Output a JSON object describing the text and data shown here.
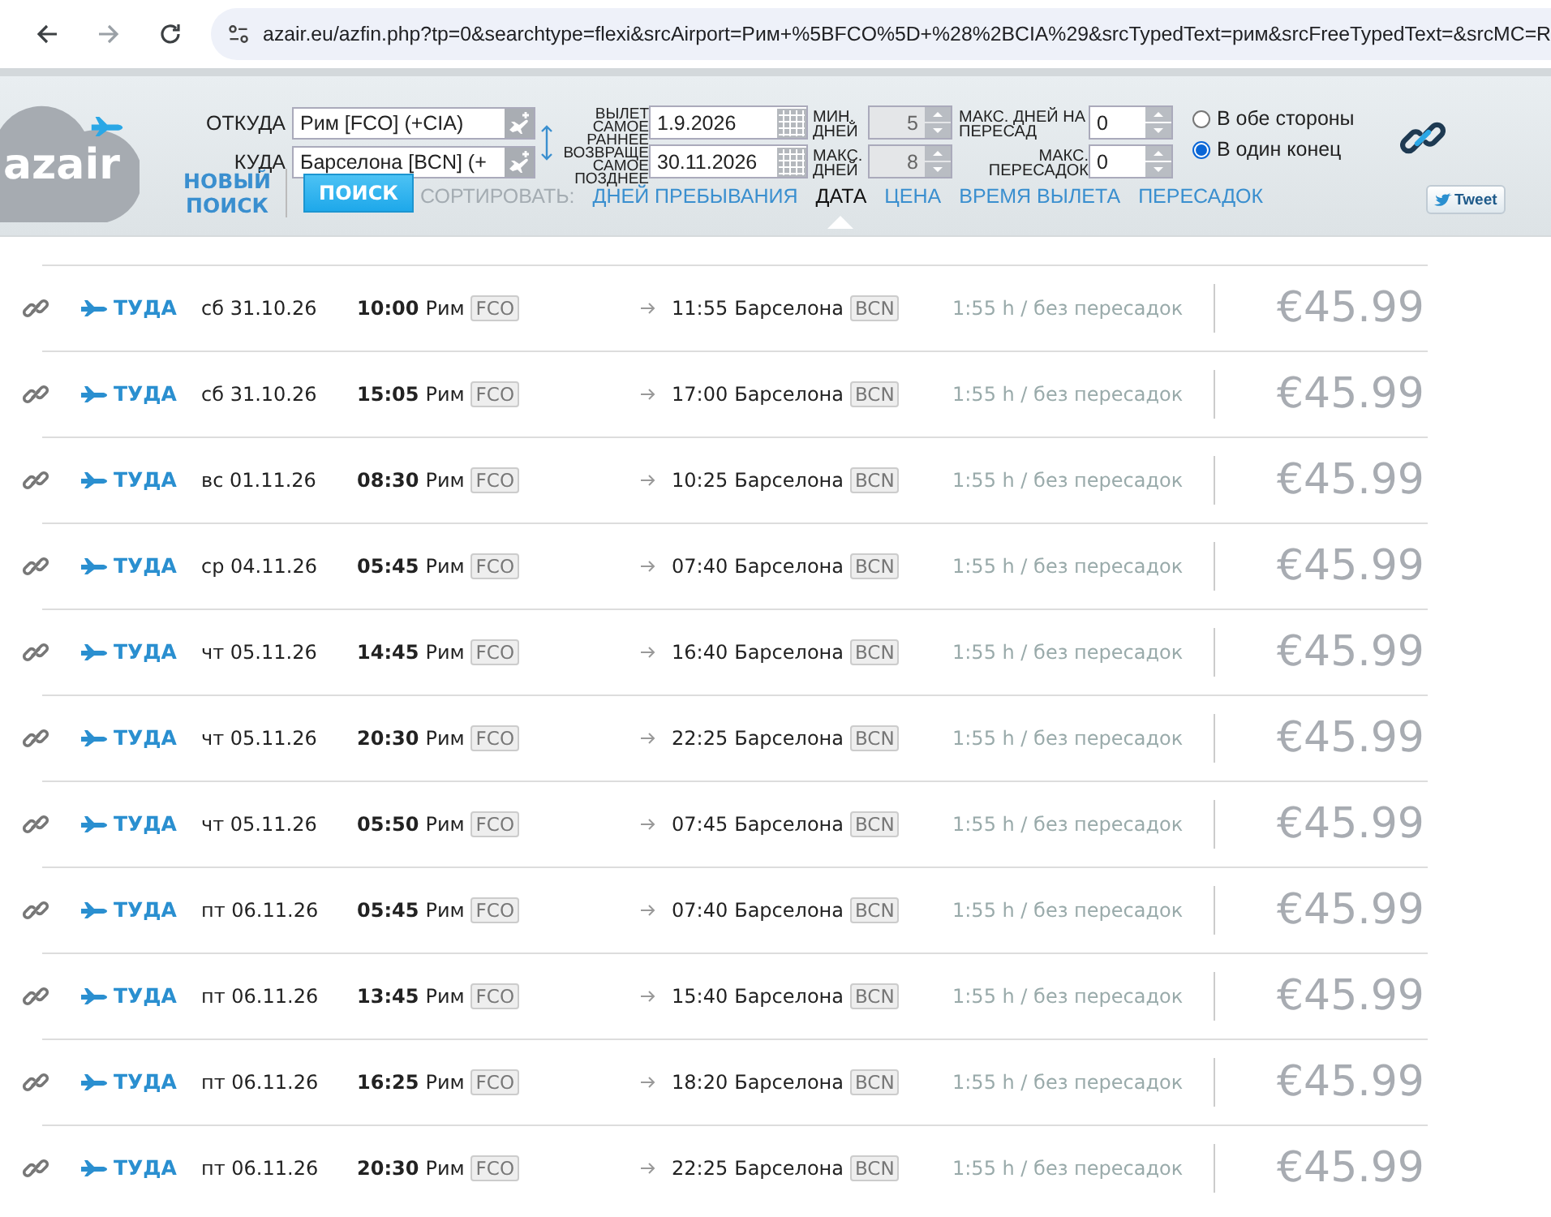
{
  "browser": {
    "nav": [
      {
        "kind": "back",
        "disabled": false
      },
      {
        "kind": "forward",
        "disabled": true
      },
      {
        "kind": "reload",
        "disabled": false
      }
    ],
    "url": "azair.eu/azfin.php?tp=0&searchtype=flexi&srcAirport=Рим+%5BFCO%5D+%28%2BCIA%29&srcTypedText=рим&srcFreeTypedText=&srcMC=R"
  },
  "logo": {
    "text": "azair"
  },
  "search": {
    "from_label": "ОТКУДА",
    "from_value": "Рим [FCO] (+CIA)",
    "to_label": "КУДА",
    "to_value": "Барселона [BCN] (+",
    "depart_label": "ВЫЛЕТ САМОЕ РАННЕЕ",
    "depart_value": "1.9.2026",
    "return_label": "ВОЗВРАЩЕ САМОЕ ПОЗДНЕЕ",
    "return_value": "30.11.2026",
    "spinners": [
      {
        "label": "МИН. ДНЕЙ",
        "value": "5",
        "disabled": true
      },
      {
        "label": "МАКС. ДНЕЙ",
        "value": "8",
        "disabled": true
      },
      {
        "label": "МАКС. ДНЕЙ НА ПЕРЕСАД",
        "value": "0",
        "disabled": false
      },
      {
        "label": "МАКС. ПЕРЕСАДОК",
        "value": "0",
        "disabled": false
      }
    ],
    "trip_type": [
      {
        "label": "В обе стороны",
        "selected": false
      },
      {
        "label": "В один конец",
        "selected": true
      }
    ],
    "new_search": "НОВЫЙ ПОИСК",
    "search_button": "ПОИСК"
  },
  "sort": {
    "label": "СОРТИРОВАТЬ:",
    "options": [
      {
        "label": "ДНЕЙ ПРЕБЫВАНИЯ",
        "selected": false
      },
      {
        "label": "ДАТА",
        "selected": true
      },
      {
        "label": "ЦЕНА",
        "selected": false
      },
      {
        "label": "ВРЕМЯ ВЫЛЕТА",
        "selected": false
      },
      {
        "label": "ПЕРЕСАДОК",
        "selected": false
      }
    ]
  },
  "tweet": "Tweet",
  "flights": [
    {
      "direction": "ТУДА",
      "date": "сб 31.10.26",
      "dep_time": "10:00",
      "origin": "Рим",
      "origin_code": "FCO",
      "arr_time": "11:55",
      "destination": "Барселона",
      "destination_code": "BCN",
      "duration": "1:55 h / без пересадок",
      "price": "€45.99"
    },
    {
      "direction": "ТУДА",
      "date": "сб 31.10.26",
      "dep_time": "15:05",
      "origin": "Рим",
      "origin_code": "FCO",
      "arr_time": "17:00",
      "destination": "Барселона",
      "destination_code": "BCN",
      "duration": "1:55 h / без пересадок",
      "price": "€45.99"
    },
    {
      "direction": "ТУДА",
      "date": "вс 01.11.26",
      "dep_time": "08:30",
      "origin": "Рим",
      "origin_code": "FCO",
      "arr_time": "10:25",
      "destination": "Барселона",
      "destination_code": "BCN",
      "duration": "1:55 h / без пересадок",
      "price": "€45.99"
    },
    {
      "direction": "ТУДА",
      "date": "ср 04.11.26",
      "dep_time": "05:45",
      "origin": "Рим",
      "origin_code": "FCO",
      "arr_time": "07:40",
      "destination": "Барселона",
      "destination_code": "BCN",
      "duration": "1:55 h / без пересадок",
      "price": "€45.99"
    },
    {
      "direction": "ТУДА",
      "date": "чт 05.11.26",
      "dep_time": "14:45",
      "origin": "Рим",
      "origin_code": "FCO",
      "arr_time": "16:40",
      "destination": "Барселона",
      "destination_code": "BCN",
      "duration": "1:55 h / без пересадок",
      "price": "€45.99"
    },
    {
      "direction": "ТУДА",
      "date": "чт 05.11.26",
      "dep_time": "20:30",
      "origin": "Рим",
      "origin_code": "FCO",
      "arr_time": "22:25",
      "destination": "Барселона",
      "destination_code": "BCN",
      "duration": "1:55 h / без пересадок",
      "price": "€45.99"
    },
    {
      "direction": "ТУДА",
      "date": "чт 05.11.26",
      "dep_time": "05:50",
      "origin": "Рим",
      "origin_code": "FCO",
      "arr_time": "07:45",
      "destination": "Барселона",
      "destination_code": "BCN",
      "duration": "1:55 h / без пересадок",
      "price": "€45.99"
    },
    {
      "direction": "ТУДА",
      "date": "пт 06.11.26",
      "dep_time": "05:45",
      "origin": "Рим",
      "origin_code": "FCO",
      "arr_time": "07:40",
      "destination": "Барселона",
      "destination_code": "BCN",
      "duration": "1:55 h / без пересадок",
      "price": "€45.99"
    },
    {
      "direction": "ТУДА",
      "date": "пт 06.11.26",
      "dep_time": "13:45",
      "origin": "Рим",
      "origin_code": "FCO",
      "arr_time": "15:40",
      "destination": "Барселона",
      "destination_code": "BCN",
      "duration": "1:55 h / без пересадок",
      "price": "€45.99"
    },
    {
      "direction": "ТУДА",
      "date": "пт 06.11.26",
      "dep_time": "16:25",
      "origin": "Рим",
      "origin_code": "FCO",
      "arr_time": "18:20",
      "destination": "Барселона",
      "destination_code": "BCN",
      "duration": "1:55 h / без пересадок",
      "price": "€45.99"
    },
    {
      "direction": "ТУДА",
      "date": "пт 06.11.26",
      "dep_time": "20:30",
      "origin": "Рим",
      "origin_code": "FCO",
      "arr_time": "22:25",
      "destination": "Барселона",
      "destination_code": "BCN",
      "duration": "1:55 h / без пересадок",
      "price": "€45.99"
    }
  ]
}
